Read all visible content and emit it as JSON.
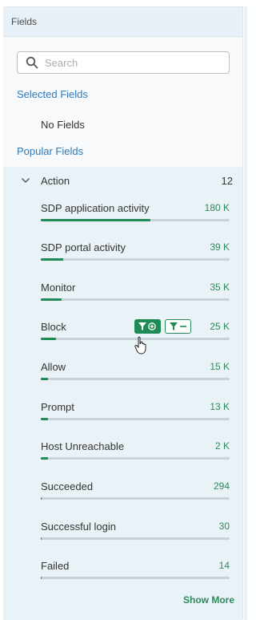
{
  "panel": {
    "title": "Fields",
    "search_placeholder": "Search",
    "selected_fields_label": "Selected Fields",
    "no_fields_text": "No Fields",
    "popular_fields_label": "Popular Fields"
  },
  "action_field": {
    "label": "Action",
    "count": "12",
    "values": [
      {
        "label": "SDP application activity",
        "count": "180 K",
        "fraction": 0.58
      },
      {
        "label": "SDP portal activity",
        "count": "39 K",
        "fraction": 0.12
      },
      {
        "label": "Monitor",
        "count": "35 K",
        "fraction": 0.11
      },
      {
        "label": "Block",
        "count": "25 K",
        "fraction": 0.08
      },
      {
        "label": "Allow",
        "count": "15 K",
        "fraction": 0.04
      },
      {
        "label": "Prompt",
        "count": "13 K",
        "fraction": 0.04
      },
      {
        "label": "Host Unreachable",
        "count": "2 K",
        "fraction": 0.005
      },
      {
        "label": "Succeeded",
        "count": "294",
        "fraction": 0.002
      },
      {
        "label": "Successful login",
        "count": "30",
        "fraction": 0.001
      },
      {
        "label": "Failed",
        "count": "14",
        "fraction": 0.001
      }
    ],
    "show_more_label": "Show More"
  },
  "colors": {
    "link": "#2f7ab8",
    "accent_green": "#1f8a55",
    "count_green": "#2e8a5a"
  }
}
